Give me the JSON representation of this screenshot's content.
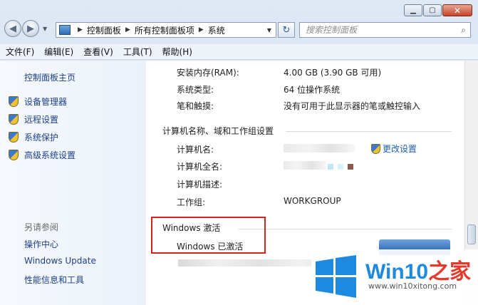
{
  "nav": {
    "crumbs": [
      "控制面板",
      "所有控制面板项",
      "系统"
    ],
    "search_placeholder": "搜索控制面板"
  },
  "menu": [
    "文件(F)",
    "编辑(E)",
    "查看(V)",
    "工具(T)",
    "帮助(H)"
  ],
  "sidebar": {
    "home": "控制面板主页",
    "items": [
      {
        "label": "设备管理器",
        "icon": "shield-icon"
      },
      {
        "label": "远程设置",
        "icon": "shield-icon"
      },
      {
        "label": "系统保护",
        "icon": "shield-icon"
      },
      {
        "label": "高级系统设置",
        "icon": "shield-icon"
      }
    ],
    "see_also": "另请参阅",
    "links": [
      "操作中心",
      "Windows Update",
      "性能信息和工具"
    ]
  },
  "system": {
    "ram_label": "安装内存(RAM):",
    "ram_value": "4.00 GB (3.90 GB 可用)",
    "type_label": "系统类型:",
    "type_value": "64 位操作系统",
    "pen_label": "笔和触摸:",
    "pen_value": "没有可用于此显示器的笔或触控输入"
  },
  "computer": {
    "section": "计算机名称、域和工作组设置",
    "name_label": "计算机名:",
    "full_label": "计算机全名:",
    "desc_label": "计算机描述:",
    "workgroup_label": "工作组:",
    "workgroup_value": "WORKGROUP",
    "change_link": "更改设置"
  },
  "activation": {
    "section": "Windows 激活",
    "status": "Windows 已激活"
  },
  "watermark": {
    "title_main": "Win10",
    "title_accent": "之家",
    "url": "www.win10xitong.com"
  },
  "colors": {
    "link": "#1b3f8b",
    "highlight": "#d6221f",
    "brand_blue": "#1d8ae0",
    "brand_red": "#e53a2b"
  }
}
